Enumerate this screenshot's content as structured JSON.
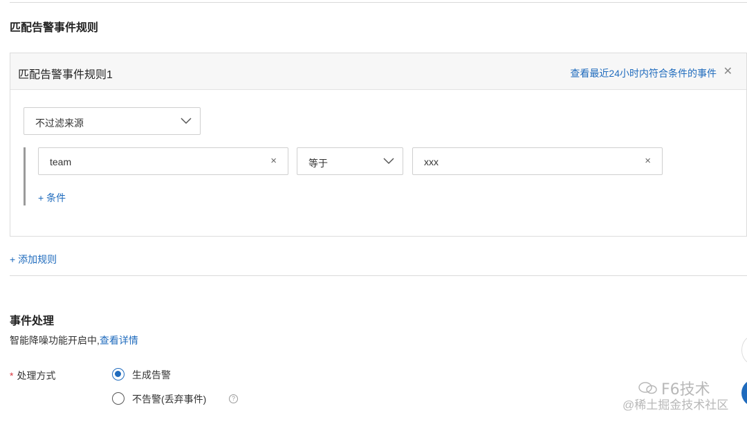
{
  "match_rules": {
    "section_title": "匹配告警事件规则",
    "rule": {
      "title": "匹配告警事件规则1",
      "view_events_link": "查看最近24小时内符合条件的事件",
      "close_icon": "close-icon",
      "source_filter": {
        "selected": "不过滤来源"
      },
      "condition": {
        "key": "team",
        "operator": "等于",
        "value": "xxx"
      },
      "add_condition": "+ 条件"
    },
    "add_rule": "+ 添加规则"
  },
  "event_handling": {
    "section_title": "事件处理",
    "description": "智能降噪功能开启中,",
    "details_link": "查看详情",
    "method_label": "处理方式",
    "required_mark": "*",
    "options": [
      {
        "label": "生成告警",
        "selected": true
      },
      {
        "label": "不告警(丢弃事件)",
        "selected": false,
        "help_icon": "question-circle-icon"
      }
    ]
  },
  "watermark": {
    "brand": "F6技术",
    "subtitle": "@稀土掘金技术社区"
  },
  "colors": {
    "accent": "#1f6bbd",
    "required": "#d9363e",
    "border": "#cfcfcf"
  }
}
